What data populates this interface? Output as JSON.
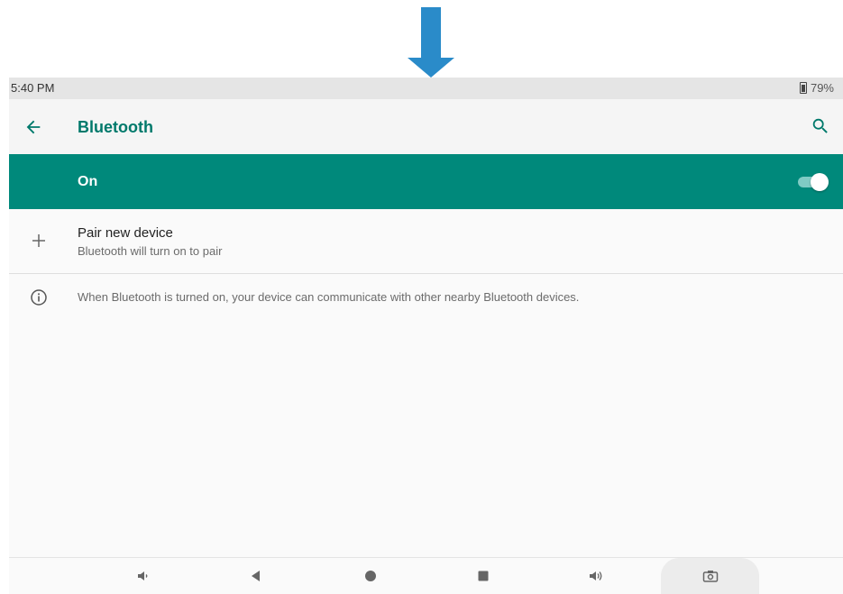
{
  "status_bar": {
    "time": "5:40 PM",
    "battery": "79%"
  },
  "app_bar": {
    "title": "Bluetooth",
    "back_icon": "arrow-back-icon",
    "search_icon": "search-icon"
  },
  "bluetooth_toggle": {
    "label": "On",
    "state": true
  },
  "pair_device": {
    "title": "Pair new device",
    "subtitle": "Bluetooth will turn on to pair"
  },
  "info": {
    "text": "When Bluetooth is turned on, your device can communicate with other nearby Bluetooth devices."
  },
  "nav_bar": {
    "buttons": [
      "volume-down-icon",
      "back-triangle-icon",
      "home-circle-icon",
      "recents-square-icon",
      "volume-up-icon",
      "screenshot-camera-icon"
    ]
  },
  "colors": {
    "accent": "#00796b",
    "toggle_bar": "#00897b",
    "pointer_arrow": "#2a8bc9"
  }
}
